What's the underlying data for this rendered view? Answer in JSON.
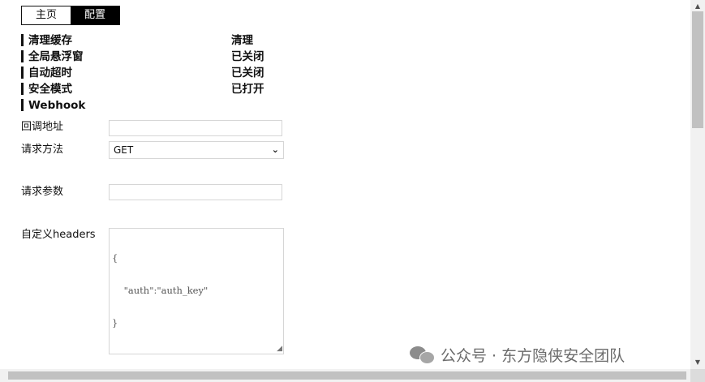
{
  "tabs": [
    {
      "label": "主页",
      "active": false
    },
    {
      "label": "配置",
      "active": true
    }
  ],
  "settings": [
    {
      "label": "清理缓存",
      "value": "清理"
    },
    {
      "label": "全局悬浮窗",
      "value": "已关闭"
    },
    {
      "label": "自动超时",
      "value": "已关闭"
    },
    {
      "label": "安全模式",
      "value": "已打开"
    },
    {
      "label": "Webhook",
      "value": ""
    }
  ],
  "webhook": {
    "callback_label": "回调地址",
    "callback_value": "",
    "method_label": "请求方法",
    "method_value": "GET",
    "params_label": "请求参数",
    "params_value": "",
    "headers_label": "自定义headers",
    "headers_lines": [
      "{",
      "    \"auth\":\"auth_key\"",
      "}"
    ]
  },
  "watermark": {
    "text": "公众号 · 东方隐侠安全团队",
    "icon": "wechat-icon"
  },
  "colors": {
    "active_tab_bg": "#000000",
    "text": "#111111",
    "scrollbar_thumb": "#c1c1c1"
  }
}
